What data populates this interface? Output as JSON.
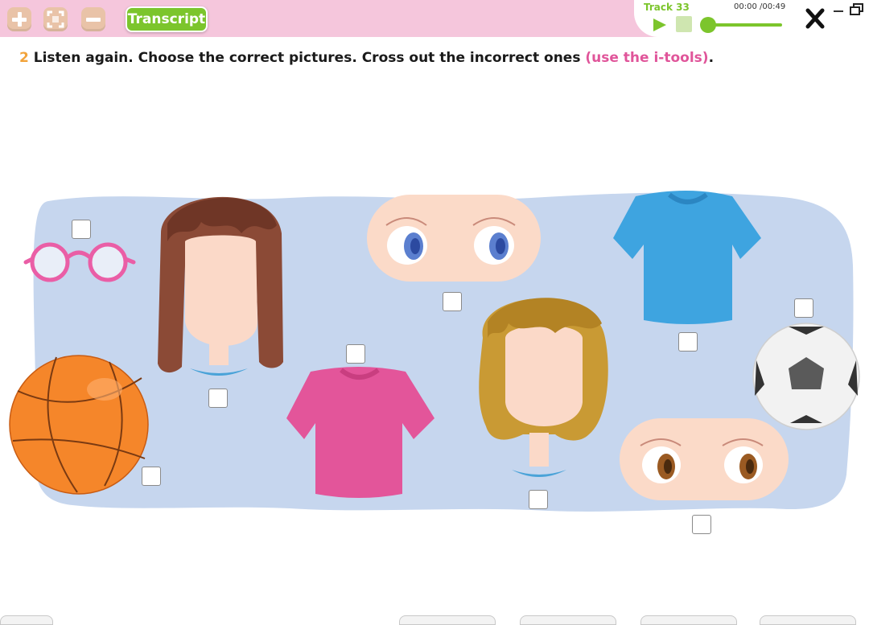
{
  "toolbar": {
    "transcript_label": "Transcript",
    "zoom_in_icon": "plus-icon",
    "fullscreen_icon": "fullscreen-icon",
    "zoom_out_icon": "minus-icon"
  },
  "player": {
    "track_label": "Track 33",
    "time": "00:00 /00:49",
    "progress": 0
  },
  "instruction": {
    "number": "2",
    "text": " Listen again. Choose the correct pictures. Cross out the incorrect ones ",
    "tools_text": "(use the i-tools)",
    "period": "."
  },
  "colors": {
    "topbar": "#f5c6dc",
    "accent_green": "#7cc52c",
    "background_blob": "#c6d6ee"
  },
  "pictures": [
    {
      "name": "glasses",
      "checked": false
    },
    {
      "name": "long-brown-hair",
      "checked": false
    },
    {
      "name": "blue-eyes",
      "checked": false
    },
    {
      "name": "blue-t-shirt",
      "checked": false
    },
    {
      "name": "basketball",
      "checked": false
    },
    {
      "name": "pink-t-shirt",
      "checked": false
    },
    {
      "name": "curly-blond-hair",
      "checked": false
    },
    {
      "name": "football",
      "checked": false
    },
    {
      "name": "brown-eyes",
      "checked": false
    }
  ]
}
